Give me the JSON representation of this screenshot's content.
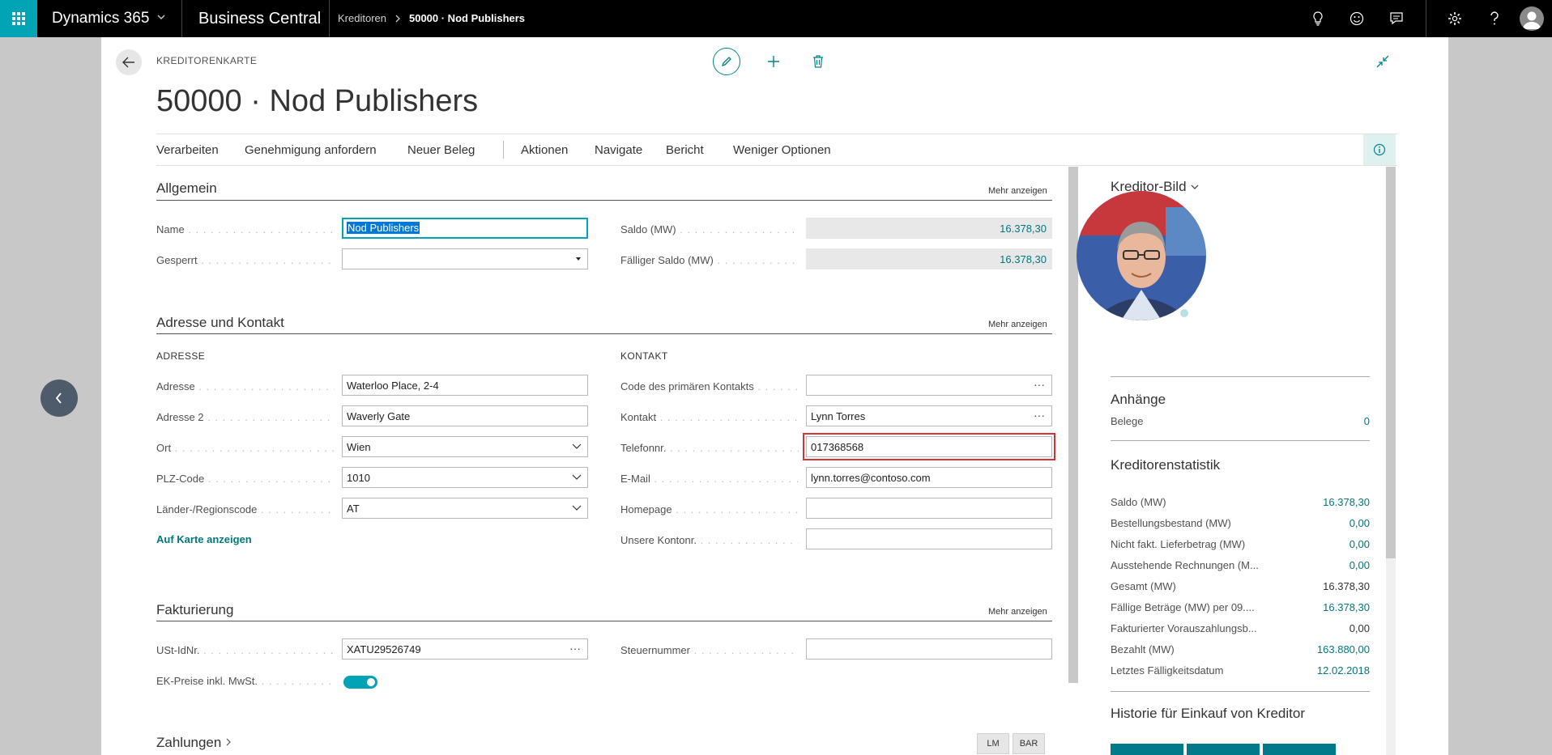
{
  "topbar": {
    "product": "Dynamics 365",
    "app": "Business Central",
    "breadcrumb": [
      "Kreditoren",
      "50000 · Nod Publishers"
    ]
  },
  "header": {
    "caption": "KREDITORENKARTE",
    "title": "50000 · Nod Publishers"
  },
  "actions": [
    "Verarbeiten",
    "Genehmigung anfordern",
    "Neuer Beleg",
    "Aktionen",
    "Navigate",
    "Bericht",
    "Weniger Optionen"
  ],
  "allgemein": {
    "title": "Allgemein",
    "more": "Mehr anzeigen",
    "name_label": "Name",
    "name_value": "Nod Publishers",
    "gesperrt_label": "Gesperrt",
    "gesperrt_value": "",
    "saldo_label": "Saldo (MW)",
    "saldo_value": "16.378,30",
    "faellig_label": "Fälliger Saldo (MW)",
    "faellig_value": "16.378,30"
  },
  "adresse": {
    "title": "Adresse und Kontakt",
    "more": "Mehr anzeigen",
    "sub_left": "ADRESSE",
    "sub_right": "KONTAKT",
    "adresse_label": "Adresse",
    "adresse_value": "Waterloo Place, 2-4",
    "adresse2_label": "Adresse 2",
    "adresse2_value": "Waverly Gate",
    "ort_label": "Ort",
    "ort_value": "Wien",
    "plz_label": "PLZ-Code",
    "plz_value": "1010",
    "land_label": "Länder-/Regionscode",
    "land_value": "AT",
    "map_link": "Auf Karte anzeigen",
    "code_label": "Code des primären Kontakts",
    "code_value": "",
    "kontakt_label": "Kontakt",
    "kontakt_value": "Lynn Torres",
    "tel_label": "Telefonnr.",
    "tel_value": "017368568",
    "email_label": "E-Mail",
    "email_value": "lynn.torres@contoso.com",
    "homepage_label": "Homepage",
    "homepage_value": "",
    "konto_label": "Unsere Kontonr.",
    "konto_value": ""
  },
  "fakturierung": {
    "title": "Fakturierung",
    "more": "Mehr anzeigen",
    "ust_label": "USt-IdNr.",
    "ust_value": "XATU29526749",
    "ek_label": "EK-Preise inkl. MwSt.",
    "ek_value": true,
    "steuer_label": "Steuernummer",
    "steuer_value": ""
  },
  "zahlungen": {
    "title": "Zahlungen",
    "pill1": "LM",
    "pill2": "BAR"
  },
  "factbox": {
    "bild_title": "Kreditor-Bild",
    "anhaenge_title": "Anhänge",
    "belege_label": "Belege",
    "belege_value": "0",
    "stat_title": "Kreditorenstatistik",
    "stats": [
      {
        "k": "Saldo (MW)",
        "v": "16.378,30",
        "link": true
      },
      {
        "k": "Bestellungsbestand (MW)",
        "v": "0,00",
        "link": true
      },
      {
        "k": "Nicht fakt. Lieferbetrag (MW)",
        "v": "0,00",
        "link": true
      },
      {
        "k": "Ausstehende Rechnungen (M...",
        "v": "0,00",
        "link": true
      },
      {
        "k": "Gesamt (MW)",
        "v": "16.378,30",
        "link": false
      },
      {
        "k": "Fällige Beträge (MW) per 09....",
        "v": "16.378,30",
        "link": true
      },
      {
        "k": "Fakturierter Vorauszahlungsb...",
        "v": "0,00",
        "link": false
      },
      {
        "k": "Bezahlt (MW)",
        "v": "163.880,00",
        "link": true
      },
      {
        "k": "Letztes Fälligkeitsdatum",
        "v": "12.02.2018",
        "link": true
      }
    ],
    "historie_title": "Historie für Einkauf von Kreditor"
  },
  "colors": {
    "accent": "#00a4b4",
    "link": "#00787d",
    "highlight": "#d13438"
  }
}
